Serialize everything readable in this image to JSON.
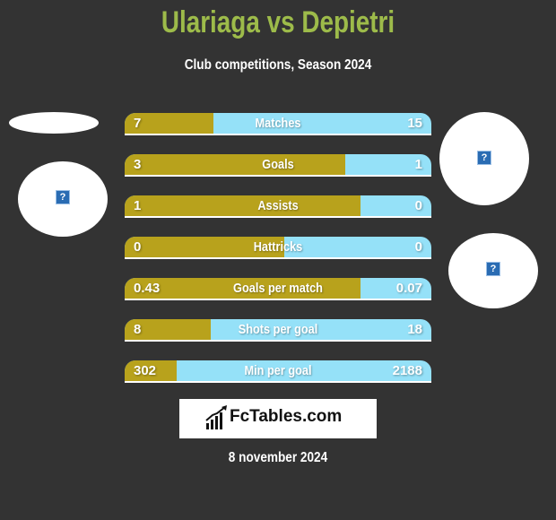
{
  "header": {
    "title": "Ulariaga vs Depietri",
    "subtitle": "Club competitions, Season 2024"
  },
  "colors": {
    "background": "#333333",
    "title": "#9dbb4a",
    "left_player": "#b8a21c",
    "right_player": "#95e1f8"
  },
  "icons": {
    "placeholder": "?"
  },
  "chart_data": {
    "type": "bar",
    "orientation": "horizontal-split",
    "title": "Ulariaga vs Depietri",
    "subtitle": "Club competitions, Season 2024",
    "series": [
      {
        "name": "Ulariaga",
        "values": [
          7,
          3,
          1,
          0,
          0.43,
          8,
          302
        ]
      },
      {
        "name": "Depietri",
        "values": [
          15,
          1,
          0,
          0,
          0.07,
          18,
          2188
        ]
      }
    ],
    "categories": [
      "Matches",
      "Goals",
      "Assists",
      "Hattricks",
      "Goals per match",
      "Shots per goal",
      "Min per goal"
    ],
    "rows": [
      {
        "label": "Matches",
        "left": "7",
        "right": "15",
        "left_share": 0.29
      },
      {
        "label": "Goals",
        "left": "3",
        "right": "1",
        "left_share": 0.72
      },
      {
        "label": "Assists",
        "left": "1",
        "right": "0",
        "left_share": 0.77
      },
      {
        "label": "Hattricks",
        "left": "0",
        "right": "0",
        "left_share": 0.52
      },
      {
        "label": "Goals per match",
        "left": "0.43",
        "right": "0.07",
        "left_share": 0.77
      },
      {
        "label": "Shots per goal",
        "left": "8",
        "right": "18",
        "left_share": 0.28
      },
      {
        "label": "Min per goal",
        "left": "302",
        "right": "2188",
        "left_share": 0.17
      }
    ]
  },
  "footer": {
    "logo_text": "FcTables.com",
    "date": "8 november 2024"
  }
}
